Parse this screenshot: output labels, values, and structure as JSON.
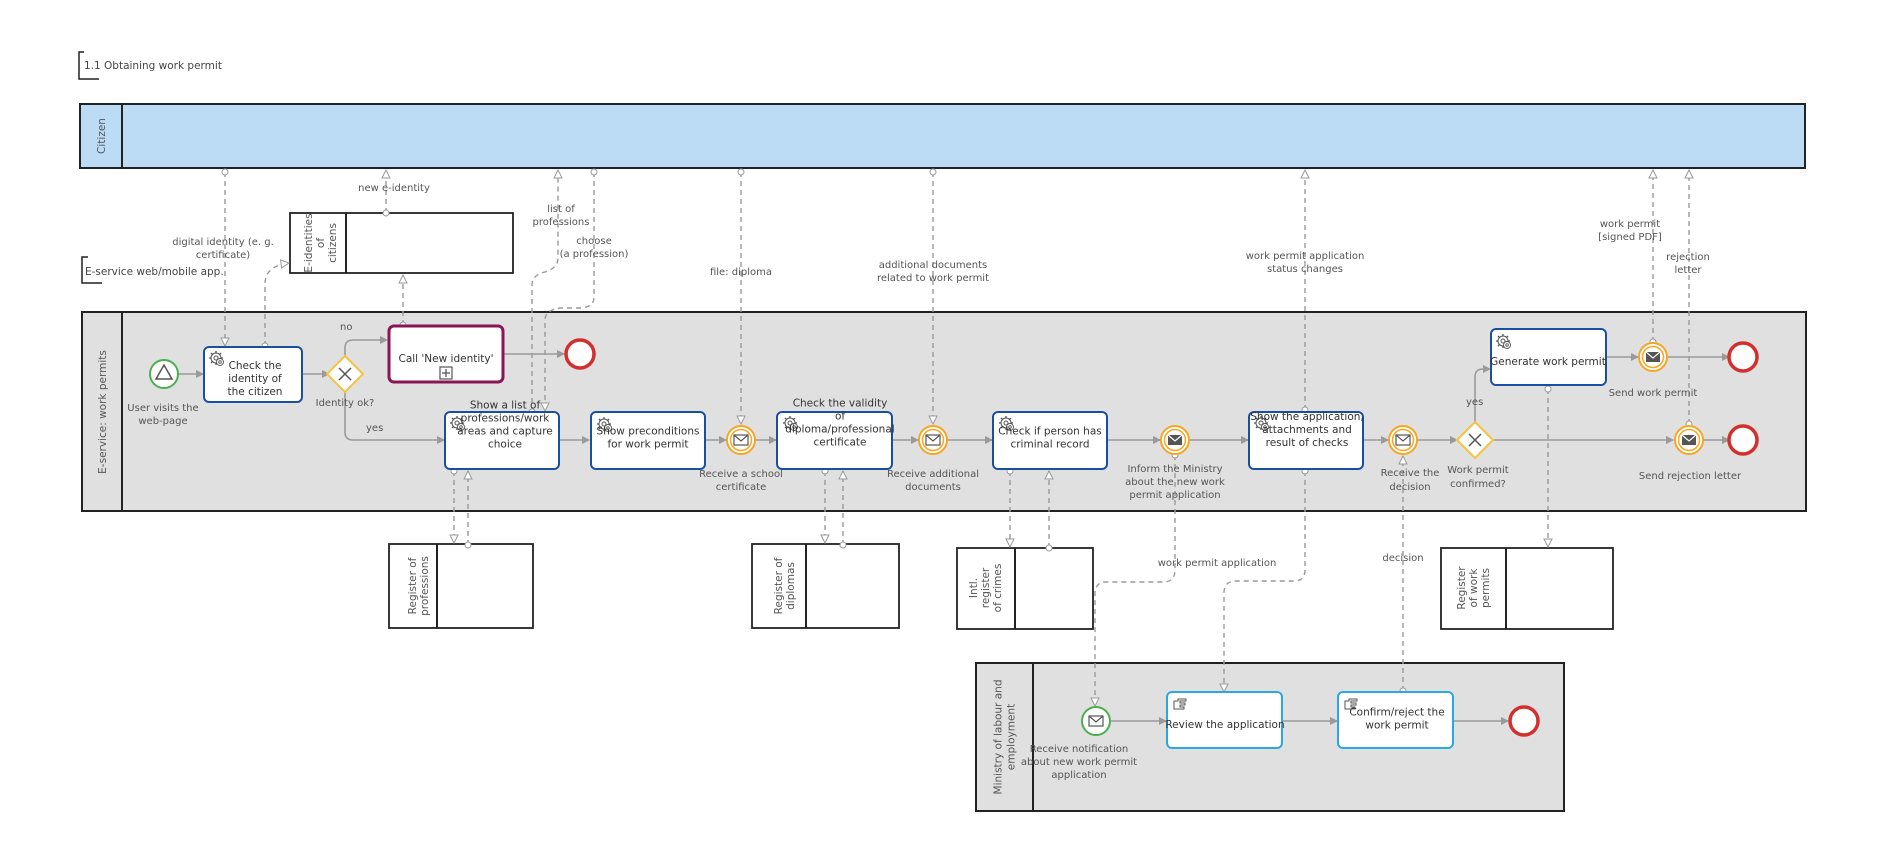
{
  "title": "1.1 Obtaining work permit",
  "group_label": "E-service web/mobile app.",
  "colors": {
    "citizen_fill": "#bcdcf6",
    "lane_fill": "#e0e0e0",
    "service_task_border": "#1a4fa0",
    "user_task_border": "#29a9e0",
    "call_activity_border": "#8a1456",
    "gateway_border": "#f5c342",
    "start_event": "#4caf50",
    "end_event": "#d32f2f",
    "intermediate_event": "#f5a623"
  },
  "pools": {
    "citizen": "Citizen",
    "eservice": "E-service: work permits",
    "ministry": "Ministry of labour and employment",
    "eidentities": [
      "E-identities",
      "of",
      "citizens"
    ],
    "reg_professions": [
      "Register of",
      "professions"
    ],
    "reg_diplomas": [
      "Register of",
      "diplomas"
    ],
    "reg_crimes": [
      "Intl.",
      "register",
      "of crimes"
    ],
    "reg_workpermits": [
      "Register",
      "of work",
      "permits"
    ]
  },
  "events": {
    "start": [
      "User visits the",
      "web-page"
    ],
    "recv_school": [
      "Receive a school",
      "certificate"
    ],
    "recv_additional": [
      "Receive additional",
      "documents"
    ],
    "inform_ministry": [
      "Inform the Ministry",
      "about the new work",
      "permit application"
    ],
    "recv_decision": [
      "Receive the",
      "decision"
    ],
    "send_permit": [
      "Send work permit"
    ],
    "send_rejection": [
      "Send rejection letter"
    ],
    "ministry_start": [
      "Receive notification",
      "about new work permit",
      "application"
    ]
  },
  "gateways": {
    "identity_ok": [
      "Identity ok?"
    ],
    "permit_confirmed": [
      "Work permit",
      "confirmed?"
    ]
  },
  "tasks": {
    "check_identity": [
      "Check the",
      "identity of",
      "the citizen"
    ],
    "call_new_identity": [
      "Call 'New identity'"
    ],
    "show_professions": [
      "Show a list of",
      "professions/work",
      "areas and capture",
      "choice"
    ],
    "show_preconditions": [
      "Show preconditions",
      "for work permit"
    ],
    "check_validity": [
      "Check the validity",
      "of",
      "diploma/professional",
      "certificate"
    ],
    "check_criminal": [
      "Check if person has",
      "criminal record"
    ],
    "show_application": [
      "Show the application,",
      "attachments and",
      "result of checks"
    ],
    "generate_permit": [
      "Generate work permit"
    ],
    "review_application": [
      "Review the application"
    ],
    "confirm_reject": [
      "Confirm/reject the",
      "work permit"
    ]
  },
  "flow_labels": {
    "no": "no",
    "yes1": "yes",
    "yes2": "yes"
  },
  "message_labels": {
    "digital_identity": [
      "digital identity (e. g.",
      "certificate)"
    ],
    "new_eidentity": [
      "new e-identity"
    ],
    "list_professions": [
      "list of",
      "professions"
    ],
    "choose_profession": [
      "choose",
      "(a profession)"
    ],
    "file_diploma": [
      "file: diploma"
    ],
    "additional_docs": [
      "additional documents",
      "related to work permit"
    ],
    "status_changes": [
      "work permit application",
      "status changes"
    ],
    "work_permit_pdf": [
      "work permit",
      "[signed PDF]"
    ],
    "rejection_letter": [
      "rejection",
      "letter"
    ],
    "work_permit_application": [
      "work permit application"
    ],
    "decision": [
      "decision"
    ]
  }
}
